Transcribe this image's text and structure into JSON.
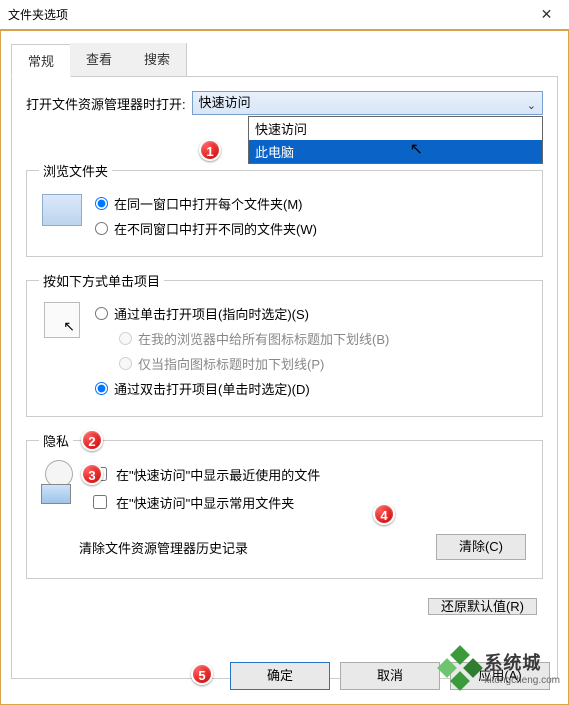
{
  "title": "文件夹选项",
  "tabs": {
    "general": "常规",
    "view": "查看",
    "search": "搜索"
  },
  "open_label": "打开文件资源管理器时打开:",
  "combo_selected": "快速访问",
  "dropdown": {
    "opt1": "快速访问",
    "opt2": "此电脑"
  },
  "browse": {
    "legend": "浏览文件夹",
    "r1": "在同一窗口中打开每个文件夹(M)",
    "r2": "在不同窗口中打开不同的文件夹(W)"
  },
  "click": {
    "legend": "按如下方式单击项目",
    "r1": "通过单击打开项目(指向时选定)(S)",
    "r1a": "在我的浏览器中给所有图标标题加下划线(B)",
    "r1b": "仅当指向图标标题时加下划线(P)",
    "r2": "通过双击打开项目(单击时选定)(D)"
  },
  "privacy": {
    "legend": "隐私",
    "c1": "在\"快速访问\"中显示最近使用的文件",
    "c2": "在\"快速访问\"中显示常用文件夹",
    "clear_label": "清除文件资源管理器历史记录",
    "clear_btn": "清除(C)"
  },
  "restore_btn": "还原默认值(R)",
  "buttons": {
    "ok": "确定",
    "cancel": "取消",
    "apply": "应用(A)"
  },
  "markers": {
    "m1": "1",
    "m2": "2",
    "m3": "3",
    "m4": "4",
    "m5": "5"
  },
  "watermark": {
    "cn": "系统城",
    "url": "xitongcheng.com"
  }
}
